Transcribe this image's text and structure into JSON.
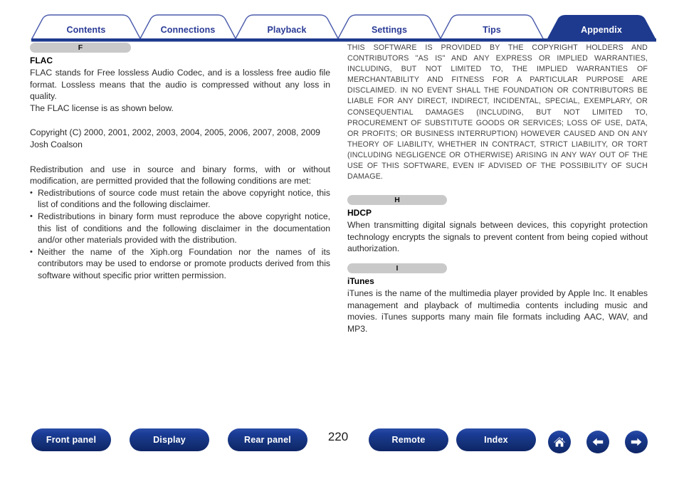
{
  "header": {
    "tabs": [
      {
        "label": "Contents",
        "active": false
      },
      {
        "label": "Connections",
        "active": false
      },
      {
        "label": "Playback",
        "active": false
      },
      {
        "label": "Settings",
        "active": false
      },
      {
        "label": "Tips",
        "active": false
      },
      {
        "label": "Appendix",
        "active": true
      }
    ],
    "accent_color": "#2a3b96",
    "active_tab_fill": "#1e3a8f"
  },
  "left_column": {
    "section_letter": "F",
    "term": "FLAC",
    "definition": "FLAC stands for Free lossless Audio Codec, and is a lossless free audio file format. Lossless means that the audio is compressed without any loss in quality.\nThe FLAC license is as shown below.",
    "definition_line1": "FLAC stands for Free lossless Audio Codec, and is a lossless free audio file format. Lossless means that the audio is compressed without any loss in quality.",
    "definition_line2": "The FLAC license is as shown below.",
    "copyright": "Copyright (C) 2000, 2001, 2002, 2003, 2004, 2005, 2006, 2007, 2008, 2009 Josh Coalson",
    "redistribution_intro": "Redistribution and use in source and binary forms, with or without modification, are permitted provided that the following conditions are met:",
    "conditions": [
      "Redistributions of source code must retain the above copyright notice, this list of conditions and the following disclaimer.",
      "Redistributions in binary form must reproduce the above copyright notice, this list of conditions and the following disclaimer in the documentation and/or other materials provided with the distribution.",
      "Neither the name of the Xiph.org Foundation nor the names of its contributors may be used to endorse or promote products derived from this software without specific prior written permission."
    ]
  },
  "right_column": {
    "disclaimer": "THIS SOFTWARE IS PROVIDED BY THE COPYRIGHT HOLDERS AND CONTRIBUTORS \"AS IS\" AND ANY EXPRESS OR IMPLIED WARRANTIES, INCLUDING, BUT NOT LIMITED TO, THE IMPLIED WARRANTIES OF MERCHANTABILITY AND FITNESS FOR A PARTICULAR PURPOSE ARE DISCLAIMED. IN NO EVENT SHALL THE FOUNDATION OR CONTRIBUTORS BE LIABLE FOR ANY DIRECT, INDIRECT, INCIDENTAL, SPECIAL, EXEMPLARY, OR CONSEQUENTIAL DAMAGES (INCLUDING, BUT NOT LIMITED TO, PROCUREMENT OF SUBSTITUTE GOODS OR SERVICES; LOSS OF USE, DATA, OR PROFITS; OR BUSINESS INTERRUPTION) HOWEVER CAUSED AND ON ANY THEORY OF LIABILITY, WHETHER IN CONTRACT, STRICT LIABILITY, OR TORT (INCLUDING NEGLIGENCE OR OTHERWISE) ARISING IN ANY WAY OUT OF THE USE OF THIS SOFTWARE, EVEN IF ADVISED OF THE POSSIBILITY OF SUCH DAMAGE.",
    "section_h": {
      "section_letter": "H",
      "term": "HDCP",
      "definition": "When transmitting digital signals between devices, this copyright protection technology encrypts the signals to prevent content from being copied without authorization."
    },
    "section_i": {
      "section_letter": "I",
      "term": "iTunes",
      "definition": "iTunes is the name of the multimedia player provided by Apple Inc. It enables management and playback of multimedia contents including music and movies. iTunes supports many main file formats including AAC, WAV, and MP3."
    }
  },
  "footer": {
    "buttons": [
      {
        "label": "Front panel"
      },
      {
        "label": "Display"
      },
      {
        "label": "Rear panel"
      },
      {
        "label": "Remote"
      },
      {
        "label": "Index"
      }
    ],
    "page_number": "220",
    "icons": [
      {
        "name": "home-icon"
      },
      {
        "name": "arrow-left-icon"
      },
      {
        "name": "arrow-right-icon"
      }
    ],
    "button_color": "#16347f"
  }
}
